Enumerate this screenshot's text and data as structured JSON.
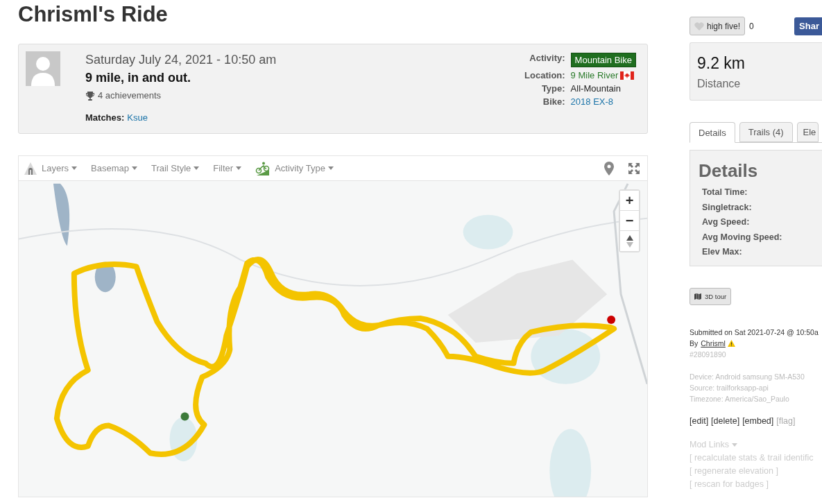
{
  "title": "Chrisml's Ride",
  "ride": {
    "date": "Saturday July 24, 2021 - 10:50 am",
    "name": "9 mile, in and out.",
    "achievements": "4 achievements",
    "matches_label": "Matches:",
    "matches_value": "Ksue",
    "fields": [
      {
        "label": "Activity:",
        "value": "Mountain Bike",
        "kind": "badge"
      },
      {
        "label": "Location:",
        "value": "9 Mile River",
        "kind": "place"
      },
      {
        "label": "Type:",
        "value": "All-Mountain",
        "kind": "text"
      },
      {
        "label": "Bike:",
        "value": "2018 EX-8",
        "kind": "link"
      }
    ]
  },
  "map_toolbar": [
    {
      "label": "Layers",
      "kind": "layers"
    },
    {
      "label": "Basemap",
      "kind": "plain"
    },
    {
      "label": "Trail Style",
      "kind": "plain"
    },
    {
      "label": "Filter",
      "kind": "plain"
    },
    {
      "label": "Activity Type",
      "kind": "activity"
    }
  ],
  "map_zoom": {
    "zoom_in": "+",
    "zoom_out": "−"
  },
  "high_five": {
    "label": "high five!",
    "count": "0"
  },
  "share": {
    "label": "Shar"
  },
  "stat": {
    "value": "9.2 km",
    "label": "Distance"
  },
  "tabs": [
    {
      "label": "Details",
      "selected": true
    },
    {
      "label": "Trails (4)",
      "selected": false
    },
    {
      "label": "Ele",
      "selected": false
    }
  ],
  "details": {
    "heading": "Details",
    "rows": [
      "Total Time:",
      "Singletrack:",
      "Avg Speed:",
      "Avg Moving Speed:",
      "Elev Max:"
    ]
  },
  "tour_button": "3D tour",
  "submitted": "Submitted on Sat 2021-07-24 @ 10:50a",
  "by_label": "By",
  "user": "Chrisml",
  "ride_id": "#28091890",
  "device": "Device: Android samsung SM-A530",
  "source": "Source: trailforksapp-api",
  "timezone": "Timezone: America/Sao_Paulo",
  "actions": [
    {
      "label": "[edit]",
      "muted": false
    },
    {
      "label": "[delete]",
      "muted": false
    },
    {
      "label": "[embed]",
      "muted": false
    },
    {
      "label": "[flag]",
      "muted": true
    }
  ],
  "mod_links": {
    "label": "Mod Links",
    "items": [
      "[ recalculate stats & trail identific",
      "[ regenerate elevation ]",
      "[ rescan for badges ]"
    ]
  }
}
